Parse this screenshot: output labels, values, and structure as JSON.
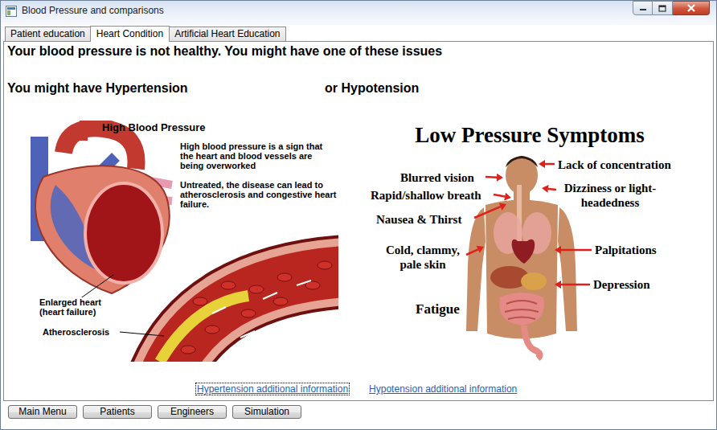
{
  "window": {
    "title": "Blood Pressure and comparisons"
  },
  "tabs": [
    {
      "label": "Patient education",
      "selected": false
    },
    {
      "label": "Heart Condition",
      "selected": true
    },
    {
      "label": "Artificial Heart Education",
      "selected": false
    }
  ],
  "heading": "Your blood pressure is not healthy. You might have one of these issues",
  "options": [
    {
      "label": "You might have Hypertension"
    },
    {
      "label": "or Hypotension"
    }
  ],
  "hypertension_figure": {
    "title": "High Blood Pressure",
    "paragraphs": [
      "High blood pressure is a sign that the heart and blood vessels are being overworked",
      "Untreated, the disease can lead to atherosclerosis and congestive heart failure."
    ],
    "labels": [
      "Enlarged heart (heart failure)",
      "Atherosclerosis"
    ]
  },
  "hypotension_figure": {
    "title": "Low Pressure Symptoms",
    "symptoms": [
      "Lack of concentration",
      "Blurred vision",
      "Dizziness or light-headedness",
      "Rapid/shallow breath",
      "Nausea & Thirst",
      "Cold, clammy, pale skin",
      "Palpitations",
      "Depression",
      "Fatigue"
    ]
  },
  "links": [
    {
      "label": "Hypertension additional information",
      "focused": true
    },
    {
      "label": "Hypotension additional information",
      "focused": false
    }
  ],
  "buttons": [
    "Main Menu",
    "Patients",
    "Engineers",
    "Simulation"
  ]
}
